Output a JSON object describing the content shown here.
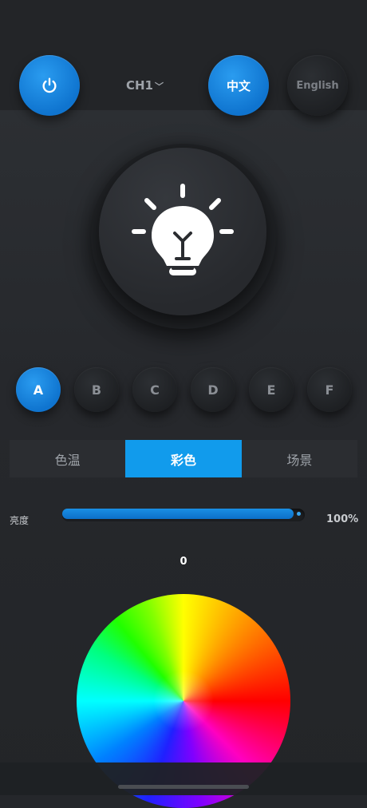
{
  "header": {
    "channel_label": "CH1",
    "lang_zh_label": "中文",
    "lang_en_label": "English"
  },
  "scenes": [
    {
      "label": "A",
      "active": true
    },
    {
      "label": "B",
      "active": false
    },
    {
      "label": "C",
      "active": false
    },
    {
      "label": "D",
      "active": false
    },
    {
      "label": "E",
      "active": false
    },
    {
      "label": "F",
      "active": false
    }
  ],
  "tabs": [
    {
      "label": "色温",
      "active": false
    },
    {
      "label": "彩色",
      "active": true
    },
    {
      "label": "场景",
      "active": false
    }
  ],
  "brightness": {
    "label": "亮度",
    "value_text": "100%",
    "fraction": 1.0
  },
  "color_wheel": {
    "hue_value": "0"
  },
  "colors": {
    "accent_blue": "#119bec",
    "background": "#25272b"
  },
  "icons": {
    "power": "power-icon",
    "bulb": "lightbulb-icon",
    "chevron": "chevron-down-icon"
  }
}
